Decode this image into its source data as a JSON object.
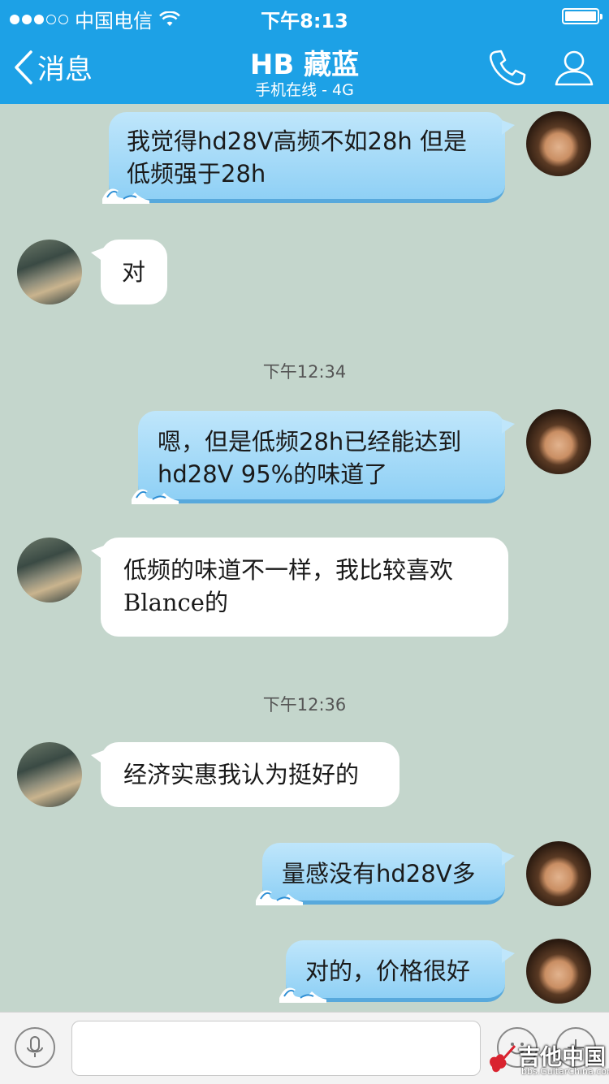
{
  "status_bar": {
    "carrier": "中国电信",
    "time": "下午8:13"
  },
  "nav": {
    "back_label": "消息",
    "title": "HB 藏蓝",
    "subtitle": "手机在线 - 4G",
    "icons": [
      "phone-icon",
      "profile-icon"
    ]
  },
  "messages": [
    {
      "sender": "me",
      "text": "我觉得hd28V高频不如28h 但是低频强于28h"
    },
    {
      "sender": "friend",
      "text": "对"
    },
    {
      "timestamp": "下午12:34"
    },
    {
      "sender": "me",
      "text": "嗯，但是低频28h已经能达到hd28V 95%的味道了"
    },
    {
      "sender": "friend",
      "text": "低频的味道不一样，我比较喜欢Blance的"
    },
    {
      "timestamp": "下午12:36"
    },
    {
      "sender": "friend",
      "text": "经济实惠我认为挺好的"
    },
    {
      "sender": "me",
      "text": "量感没有hd28V多"
    },
    {
      "sender": "me",
      "text": "对的，价格很好"
    }
  ],
  "input_bar": {
    "icons": [
      "microphone-icon",
      "emoji-icon",
      "plus-icon"
    ]
  },
  "watermark": {
    "title": "吉他中国",
    "url": "bbs.GuitarChina.com"
  },
  "colors": {
    "header": "#1da1e6",
    "background": "#c4d6cc",
    "my_bubble": "#a8dcf8",
    "friend_bubble": "#ffffff"
  }
}
